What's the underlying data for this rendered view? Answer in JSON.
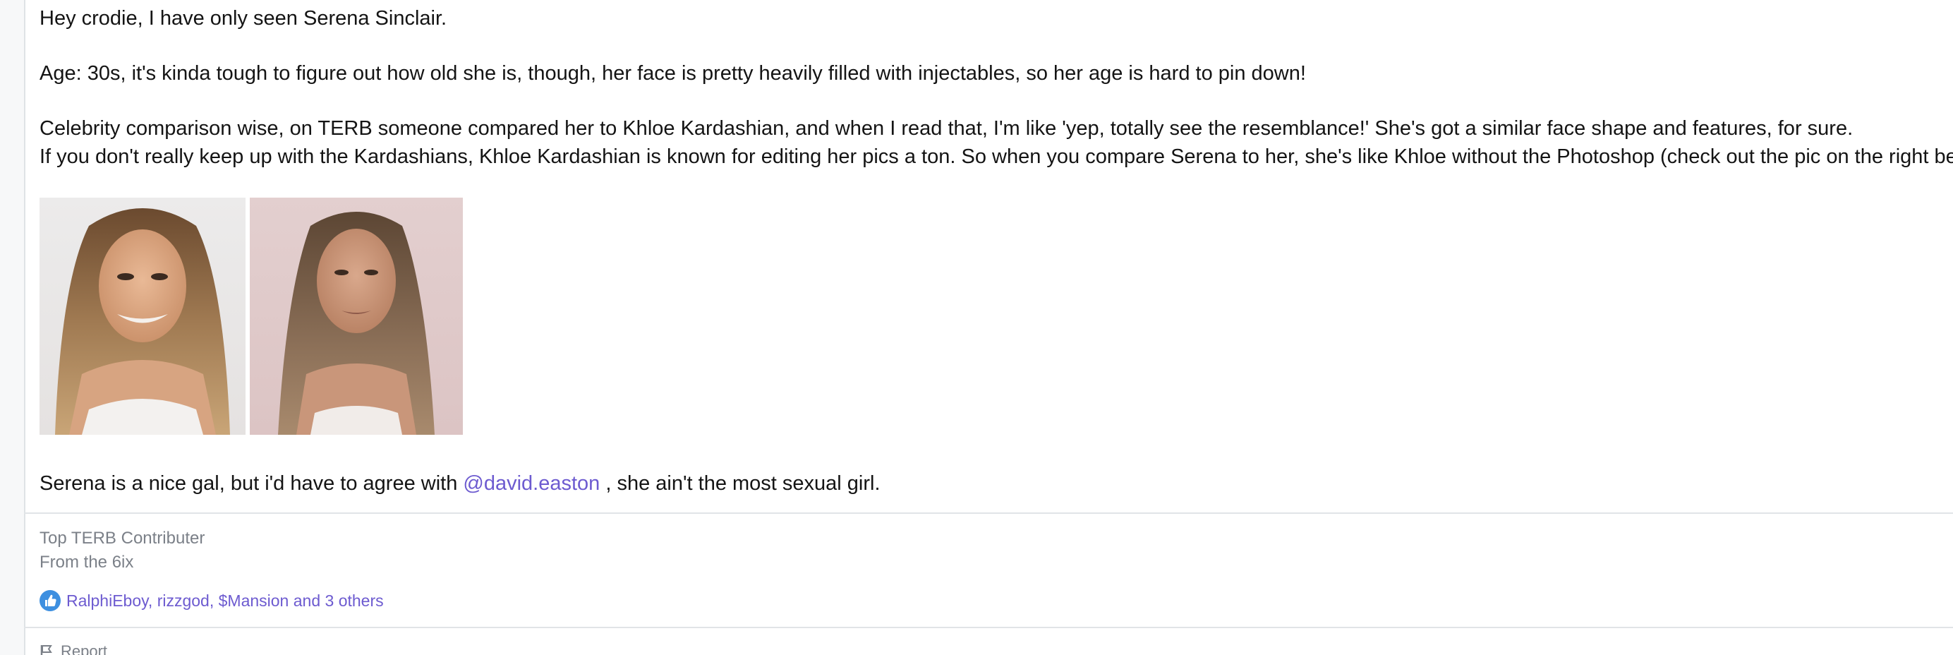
{
  "post": {
    "line_1": "Hey crodie, I have only seen Serena Sinclair.",
    "line_2": "Age: 30s, it's kinda tough to figure out how old she is, though, her face is pretty heavily filled with injectables, so her age is hard to pin down!",
    "line_3": "Celebrity comparison wise, on TERB someone compared her to Khloe Kardashian, and when I read that, I'm like 'yep, totally see the resemblance!' She's got a similar face shape and features, for sure.",
    "line_4": "If you don't really keep up with the Kardashians, Khloe Kardashian is known for editing her pics a ton. So when you compare Serena to her, she's like Khloe without the Photoshop (check out the pic on the right below).",
    "line_5_before": "Serena is a nice gal, but i'd have to agree with ",
    "mention": "@david.easton",
    "line_5_after": " , she ain't the most sexual girl."
  },
  "signature": {
    "line_1": "Top TERB Contributer",
    "line_2": "From the 6ix"
  },
  "reactions": {
    "icon": "thumbs-up-icon",
    "text": "RalphiEboy, rizzgod, $Mansion and 3 others"
  },
  "footer": {
    "icon": "flag-icon",
    "label": "Report"
  },
  "colors": {
    "link": "#6d5bd0",
    "muted": "#7b8088",
    "like_badge": "#3d8fe0"
  }
}
